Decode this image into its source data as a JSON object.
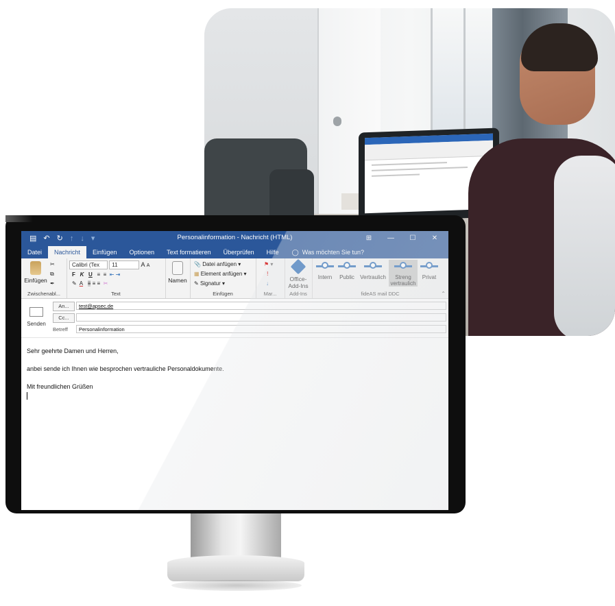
{
  "window": {
    "title": "Personalinformation  -  Nachricht (HTML)",
    "controls": [
      "⊞",
      "—",
      "☐",
      "✕"
    ],
    "quick_access": [
      "💾",
      "↶",
      "↻",
      "↑",
      "↓",
      "▾"
    ]
  },
  "tabs": [
    {
      "label": "Datei",
      "active": false
    },
    {
      "label": "Nachricht",
      "active": true
    },
    {
      "label": "Einfügen",
      "active": false
    },
    {
      "label": "Optionen",
      "active": false
    },
    {
      "label": "Text formatieren",
      "active": false
    },
    {
      "label": "Überprüfen",
      "active": false
    },
    {
      "label": "Hilfe",
      "active": false
    }
  ],
  "tell_me": {
    "icon": "lightbulb-icon",
    "text": "Was möchten Sie tun?"
  },
  "ribbon": {
    "clipboard": {
      "paste_label": "Einfügen",
      "group_label": "Zwischenabl..."
    },
    "text": {
      "font_name": "Calibri (Tex",
      "font_size": "11",
      "grow": "A",
      "shrink": "A",
      "bold": "F",
      "italic": "K",
      "underline": "U",
      "group_label": "Text"
    },
    "names": {
      "label": "Namen"
    },
    "include": {
      "attach_file": "Datei anfügen",
      "attach_item": "Element anfügen",
      "signature": "Signatur",
      "group_label": "Einfügen"
    },
    "tags": {
      "group_label": "Mar..."
    },
    "addins": {
      "button_label_line1": "Office-",
      "button_label_line2": "Add-Ins",
      "group_label": "Add-Ins"
    },
    "ddc": {
      "buttons": [
        {
          "label": "Intern",
          "selected": false
        },
        {
          "label": "Public",
          "selected": false
        },
        {
          "label": "Vertraulich",
          "selected": false
        },
        {
          "label": "Streng",
          "label2": "vertraulich",
          "selected": true
        },
        {
          "label": "Privat",
          "selected": false
        }
      ],
      "group_label": "fideAS mail DDC"
    }
  },
  "compose": {
    "send_label": "Senden",
    "to_button": "An...",
    "cc_button": "Cc...",
    "subject_label": "Betreff",
    "to_value": "test@apsec.de",
    "cc_value": "",
    "subject_value": "Personalinformation"
  },
  "body": {
    "lines": [
      "Sehr geehrte Damen und Herren,",
      "anbei sende ich Ihnen wie besprochen vertrauliche Personaldokumente.",
      "Mit freundlichen Grüßen"
    ]
  },
  "colors": {
    "title_bar": "#2b579a",
    "ribbon_bg": "#f3f3f3",
    "accent": "#2f6fb8",
    "flag_red": "#d83b3b"
  }
}
